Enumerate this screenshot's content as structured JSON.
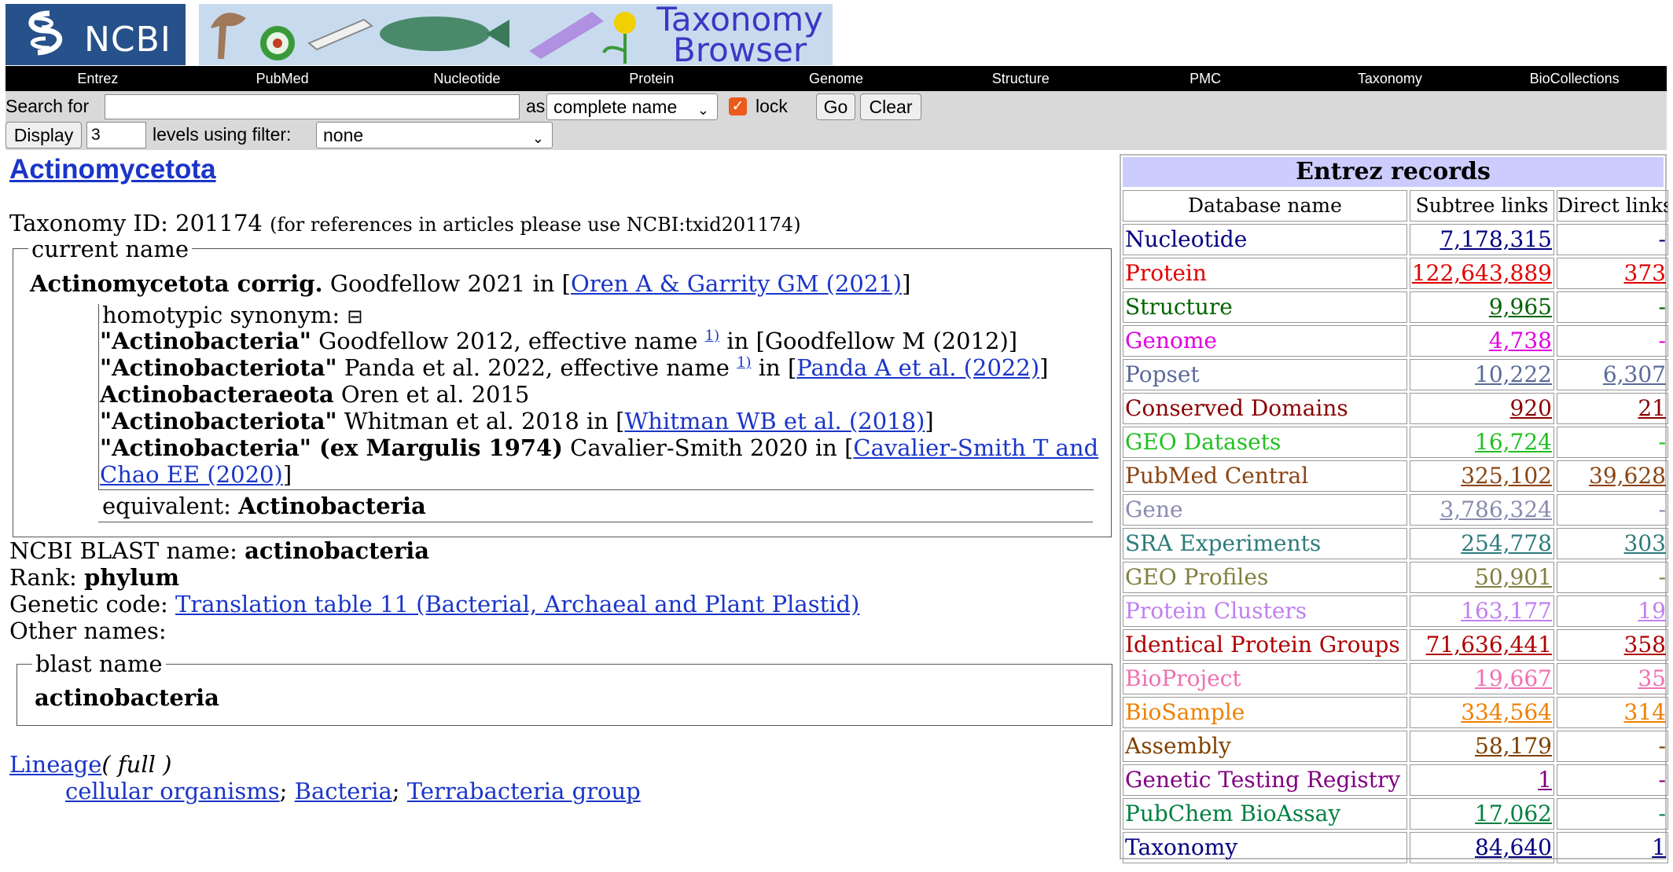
{
  "banner": {
    "ncbi_text": "NCBI",
    "title_line1": "Taxonomy",
    "title_line2": "Browser"
  },
  "nav": [
    "Entrez",
    "PubMed",
    "Nucleotide",
    "Protein",
    "Genome",
    "Structure",
    "PMC",
    "Taxonomy",
    "BioCollections"
  ],
  "search": {
    "label": "Search for",
    "value": "",
    "as_label": "as",
    "mode": "complete name",
    "lock_label": "lock",
    "lock_checked": true,
    "go": "Go",
    "clear": "Clear",
    "display_button": "Display",
    "levels": "3",
    "levels_label": "levels using filter:",
    "filter": "none"
  },
  "taxon": {
    "name": "Actinomycetota",
    "id_label": "Taxonomy ID:",
    "id": "201174",
    "id_note": "(for references in articles please use NCBI:txid201174)",
    "current_name_legend": "current name",
    "current_bold": "Actinomycetota corrig.",
    "current_rest": "Goodfellow 2021 in [",
    "current_ref": "Oren A & Garrity GM (2021)",
    "current_end": "]",
    "homotypic_label": "homotypic synonym:",
    "homotypic_toggle": "⊟",
    "syn1_bold": "\"Actinobacteria\"",
    "syn1_rest": "Goodfellow 2012, effective name",
    "syn1_sup": "1)",
    "syn1_ref": "in [Goodfellow M (2012)]",
    "syn2_bold": "\"Actinobacteriota\"",
    "syn2_rest": "Panda et al. 2022, effective name",
    "syn2_sup": "1)",
    "syn2_in": "in [",
    "syn2_ref": "Panda A et al. (2022)",
    "syn2_end": "]",
    "syn3_bold": "Actinobacteraeota",
    "syn3_rest": "Oren et al. 2015",
    "syn4_bold": "\"Actinobacteriota\"",
    "syn4_rest": "Whitman et al. 2018 in [",
    "syn4_ref": "Whitman WB et al. (2018)",
    "syn4_end": "]",
    "syn5_bold": "\"Actinobacteria\" (ex Margulis 1974)",
    "syn5_rest": "Cavalier-Smith 2020 in [",
    "syn5_ref1": "Cavalier-Smith T and",
    "syn5_ref2": "Chao EE (2020)",
    "syn5_end": "]",
    "equivalent_label": "equivalent:",
    "equivalent_value": "Actinobacteria",
    "blast_label": "NCBI BLAST name:",
    "blast_value": "actinobacteria",
    "rank_label": "Rank:",
    "rank_value": "phylum",
    "genetic_label": "Genetic code:",
    "genetic_value": "Translation table 11 (Bacterial, Archaeal and Plant Plastid)",
    "other_names_label": "Other names:",
    "blast_legend": "blast name",
    "blast_name": "actinobacteria",
    "lineage_link": "Lineage",
    "lineage_full": "( full )",
    "lineage": [
      "cellular organisms",
      "Bacteria",
      "Terrabacteria group"
    ]
  },
  "entrez": {
    "title": "Entrez records",
    "col_db": "Database name",
    "col_subtree": "Subtree links",
    "col_direct": "Direct links",
    "rows": [
      {
        "db": "Nucleotide",
        "subtree": "7,178,315",
        "direct": "-",
        "color": "#000080"
      },
      {
        "db": "Protein",
        "subtree": "122,643,889",
        "direct": "373",
        "color": "#e00000"
      },
      {
        "db": "Structure",
        "subtree": "9,965",
        "direct": "-",
        "color": "#006400"
      },
      {
        "db": "Genome",
        "subtree": "4,738",
        "direct": "-",
        "color": "#e000e0"
      },
      {
        "db": "Popset",
        "subtree": "10,222",
        "direct": "6,307",
        "color": "#5a6a9a"
      },
      {
        "db": "Conserved Domains",
        "subtree": "920",
        "direct": "21",
        "color": "#8b0000"
      },
      {
        "db": "GEO Datasets",
        "subtree": "16,724",
        "direct": "-",
        "color": "#20c020"
      },
      {
        "db": "PubMed Central",
        "subtree": "325,102",
        "direct": "39,628",
        "color": "#8b4513"
      },
      {
        "db": "Gene",
        "subtree": "3,786,324",
        "direct": "-",
        "color": "#8a8ab0"
      },
      {
        "db": "SRA Experiments",
        "subtree": "254,778",
        "direct": "303",
        "color": "#2e7b7b"
      },
      {
        "db": "GEO Profiles",
        "subtree": "50,901",
        "direct": "-",
        "color": "#808040"
      },
      {
        "db": "Protein Clusters",
        "subtree": "163,177",
        "direct": "19",
        "color": "#c080f0"
      },
      {
        "db": "Identical Protein Groups",
        "subtree": "71,636,441",
        "direct": "358",
        "color": "#b00000"
      },
      {
        "db": "BioProject",
        "subtree": "19,667",
        "direct": "35",
        "color": "#f070b0"
      },
      {
        "db": "BioSample",
        "subtree": "334,564",
        "direct": "314",
        "color": "#f08000"
      },
      {
        "db": "Assembly",
        "subtree": "58,179",
        "direct": "-",
        "color": "#804000"
      },
      {
        "db": "Genetic Testing Registry",
        "subtree": "1",
        "direct": "-",
        "color": "#800080"
      },
      {
        "db": "PubChem BioAssay",
        "subtree": "17,062",
        "direct": "-",
        "color": "#008040"
      },
      {
        "db": "Taxonomy",
        "subtree": "84,640",
        "direct": "1",
        "color": "#000080"
      }
    ]
  }
}
